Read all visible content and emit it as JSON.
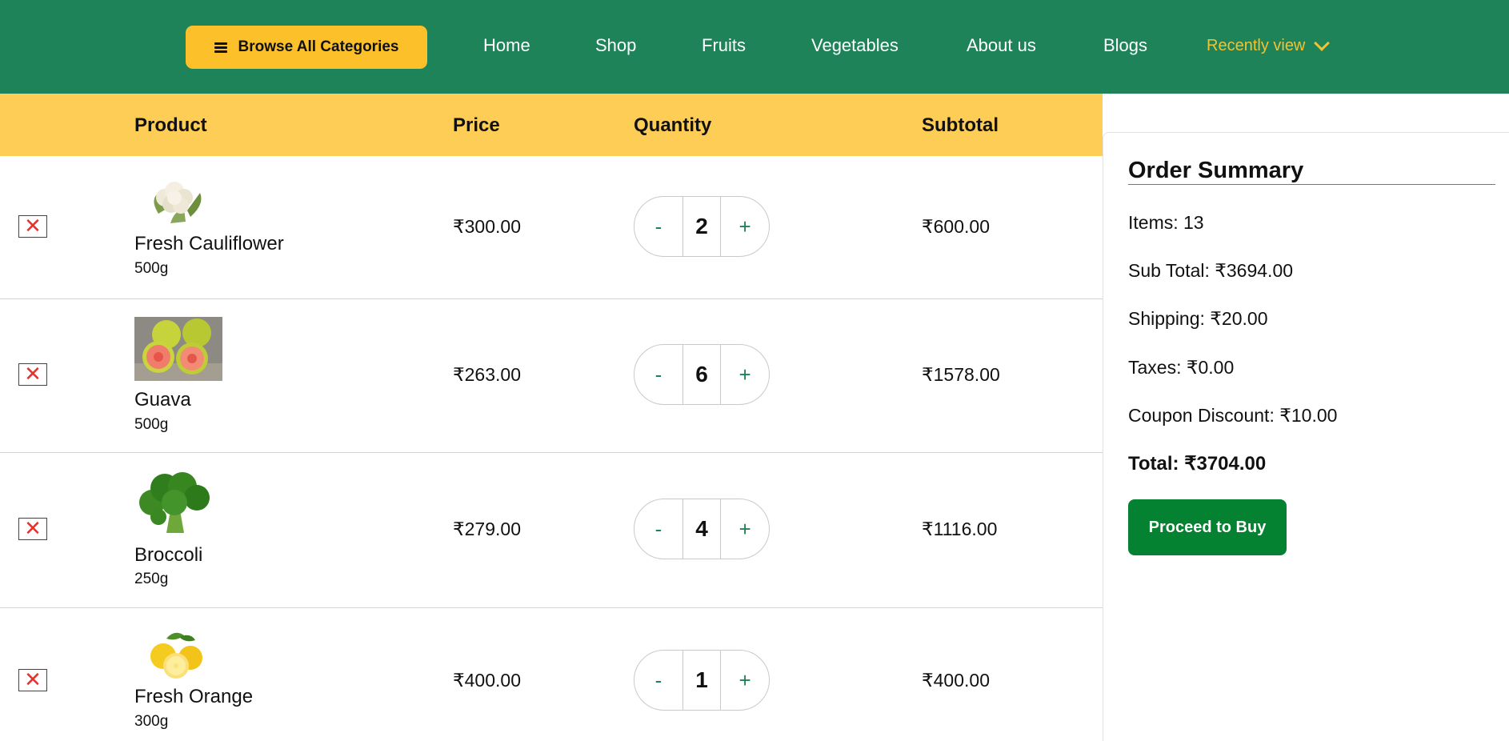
{
  "header": {
    "browse_label": "Browse All Categories",
    "nav": [
      "Home",
      "Shop",
      "Fruits",
      "Vegetables",
      "About us",
      "Blogs"
    ],
    "recent_label": "Recently view"
  },
  "table": {
    "headers": {
      "product": "Product",
      "price": "Price",
      "quantity": "Quantity",
      "subtotal": "Subtotal"
    },
    "remove_glyph": "✕",
    "rows": [
      {
        "name": "Fresh Cauliflower",
        "weight": "500g",
        "price": "₹300.00",
        "qty": "2",
        "subtotal": "₹600.00"
      },
      {
        "name": "Guava",
        "weight": "500g",
        "price": "₹263.00",
        "qty": "6",
        "subtotal": "₹1578.00"
      },
      {
        "name": "Broccoli",
        "weight": "250g",
        "price": "₹279.00",
        "qty": "4",
        "subtotal": "₹1116.00"
      },
      {
        "name": "Fresh Orange",
        "weight": "300g",
        "price": "₹400.00",
        "qty": "1",
        "subtotal": "₹400.00"
      }
    ],
    "minus": "-",
    "plus": "+"
  },
  "summary": {
    "title": "Order Summary",
    "items": "Items: 13",
    "subtotal": "Sub Total: ₹3694.00",
    "shipping": "Shipping: ₹20.00",
    "taxes": "Taxes: ₹0.00",
    "coupon": "Coupon Discount: ₹10.00",
    "total": "Total: ₹3704.00",
    "buy_label": "Proceed to Buy"
  },
  "colors": {
    "header_bg": "#1e8359",
    "browse_btn": "#fcc02a",
    "table_header": "#fecd55",
    "recent_view": "#f3c232",
    "remove_x": "#e5322d",
    "buy_btn": "#048231"
  }
}
